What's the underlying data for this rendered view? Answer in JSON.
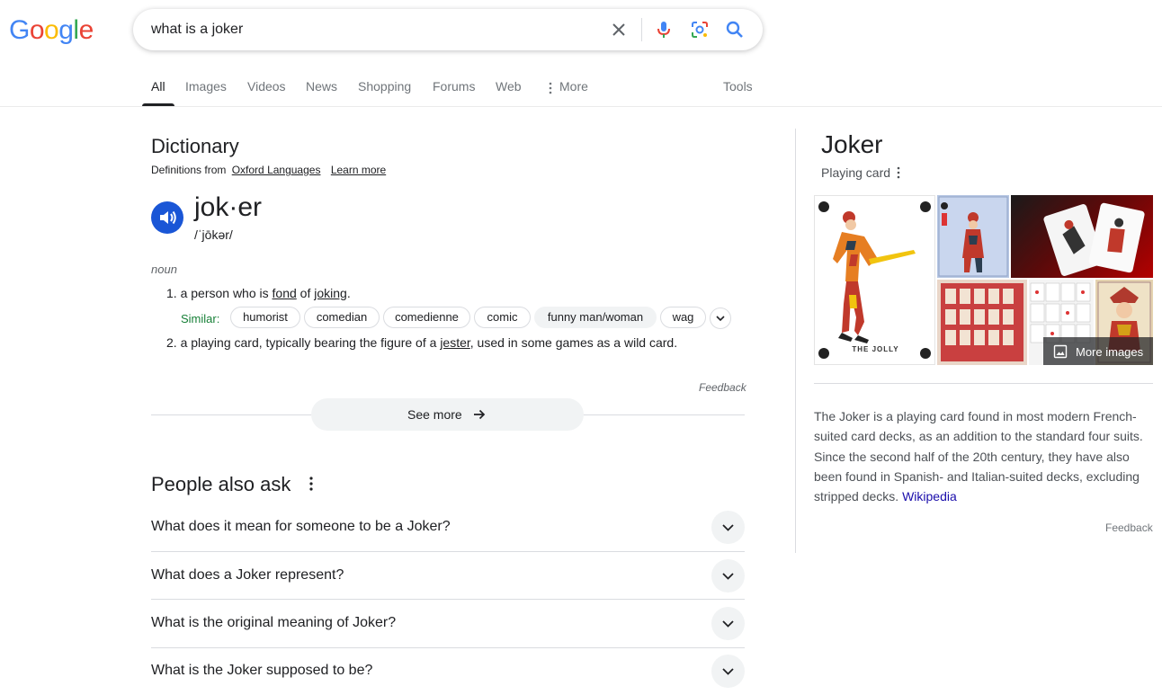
{
  "header": {
    "logo_letters": [
      "G",
      "o",
      "o",
      "g",
      "l",
      "e"
    ],
    "logo_colors": [
      "#4285F4",
      "#EA4335",
      "#FBBC05",
      "#4285F4",
      "#34A853",
      "#EA4335"
    ],
    "search_value": "what is a joker"
  },
  "tabs": [
    {
      "label": "All",
      "active": true
    },
    {
      "label": "Images"
    },
    {
      "label": "Videos"
    },
    {
      "label": "News"
    },
    {
      "label": "Shopping"
    },
    {
      "label": "Forums"
    },
    {
      "label": "Web"
    },
    {
      "label": "More"
    },
    {
      "label": "Tools"
    }
  ],
  "dictionary": {
    "title": "Dictionary",
    "source_prefix": "Definitions from",
    "source_link": "Oxford Languages",
    "learn_more": "Learn more",
    "word": "jok·er",
    "phonetic": "/ˈjōkər/",
    "part_of_speech": "noun",
    "def1": {
      "num": "1.",
      "pre": "a person who is",
      "link1": "fond",
      "mid": "of",
      "link2": "joking",
      "post": "."
    },
    "similar_label": "Similar:",
    "similar": [
      "humorist",
      "comedian",
      "comedienne",
      "comic",
      "funny man/woman",
      "wag"
    ],
    "def2": {
      "num": "2.",
      "pre": "a playing card, typically bearing the figure of a",
      "link": "jester",
      "post": ", used in some games as a wild card."
    },
    "feedback": "Feedback",
    "see_more": "See more"
  },
  "paa": {
    "title": "People also ask",
    "questions": [
      "What does it mean for someone to be a Joker?",
      "What does a Joker represent?",
      "What is the original meaning of Joker?",
      "What is the Joker supposed to be?"
    ]
  },
  "knowledge_panel": {
    "title": "Joker",
    "subtitle": "Playing card",
    "more_images": "More images",
    "image_card_caption": "THE JOLLY",
    "description": "The Joker is a playing card found in most modern French-suited card decks, as an addition to the standard four suits. Since the second half of the 20th century, they have also been found in Spanish- and Italian-suited decks, excluding stripped decks.",
    "source": "Wikipedia",
    "feedback": "Feedback"
  },
  "colors": {
    "accent_blue": "#1a56d6",
    "similar_green": "#188038",
    "link_blue": "#1a0dab"
  }
}
